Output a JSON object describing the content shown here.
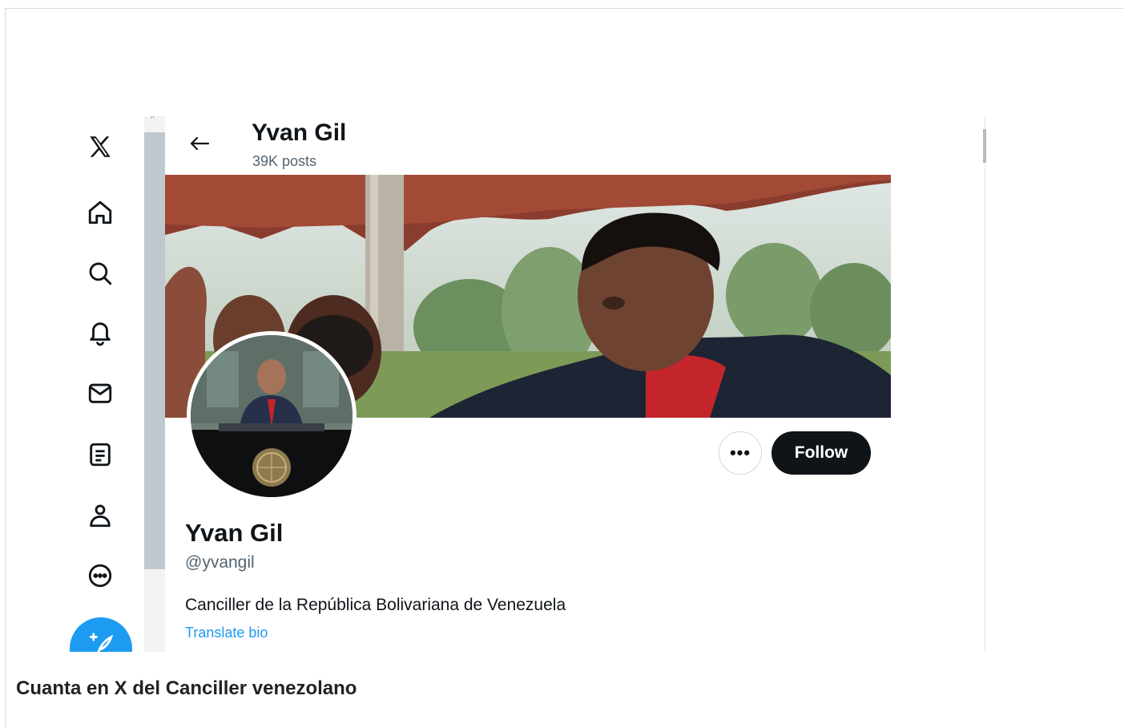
{
  "nav": {
    "items": [
      {
        "name": "x-logo-icon"
      },
      {
        "name": "home-icon"
      },
      {
        "name": "search-icon"
      },
      {
        "name": "notifications-icon"
      },
      {
        "name": "messages-icon"
      },
      {
        "name": "lists-icon"
      },
      {
        "name": "profile-icon"
      },
      {
        "name": "more-icon"
      }
    ],
    "compose": "compose-icon"
  },
  "header": {
    "name": "Yvan Gil",
    "posts": "39K posts"
  },
  "profile": {
    "display_name": "Yvan Gil",
    "handle": "@yvangil",
    "bio": "Canciller de la República Bolivariana de Venezuela",
    "translate_label": "Translate bio",
    "more_label": "•••",
    "follow_label": "Follow"
  },
  "caption": "Cuanta en X del Canciller venezolano",
  "colors": {
    "accent": "#1d9bf0",
    "follow_bg": "#0f1419",
    "secondary_text": "#536471"
  }
}
